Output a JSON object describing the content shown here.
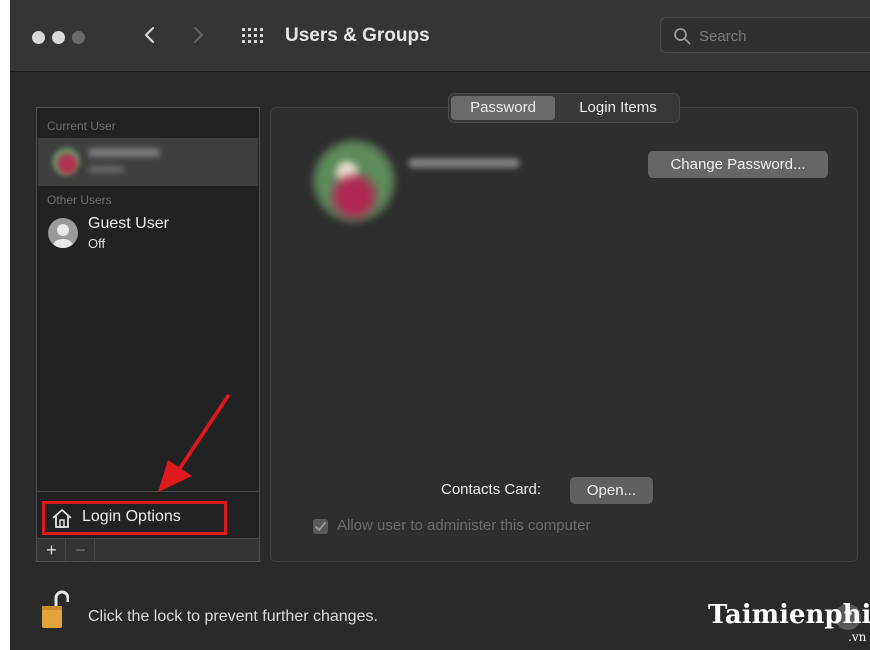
{
  "window": {
    "title": "Users & Groups"
  },
  "search": {
    "placeholder": "Search"
  },
  "sidebar": {
    "current_user_section": "Current User",
    "other_users_section": "Other Users",
    "guest_user": {
      "name": "Guest User",
      "status": "Off"
    },
    "login_options_label": "Login Options",
    "add_label": "+",
    "remove_label": "−"
  },
  "tabs": {
    "password": "Password",
    "login_items": "Login Items"
  },
  "main": {
    "change_password_label": "Change Password...",
    "contacts_card_label": "Contacts Card:",
    "open_label": "Open...",
    "admin_checkbox_label": "Allow user to administer this computer",
    "admin_checked": true
  },
  "footer": {
    "lock_text": "Click the lock to prevent further changes.",
    "help_label": "?"
  },
  "watermark": {
    "text": "Taimienphi",
    "sub": ".vn"
  },
  "colors": {
    "window_bg": "#2a2a2a",
    "annotation_red": "#e0191f",
    "lock_gold": "#e0a43a"
  },
  "icons": [
    "back-chevron-icon",
    "forward-chevron-icon",
    "grid-icon",
    "search-icon",
    "user-silhouette-icon",
    "home-icon",
    "checkmark-icon",
    "lock-icon",
    "arrow-annotation-icon"
  ]
}
